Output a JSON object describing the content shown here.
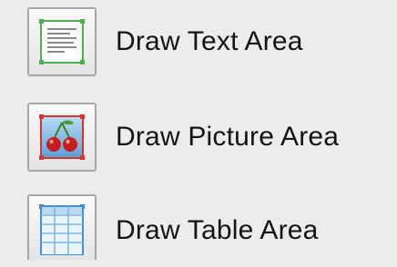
{
  "tools": [
    {
      "label": "Draw Text Area",
      "icon": "text-area-icon",
      "frame_color": "#4caf50"
    },
    {
      "label": "Draw Picture Area",
      "icon": "picture-area-icon",
      "frame_color": "#d9342b"
    },
    {
      "label": "Draw Table Area",
      "icon": "table-area-icon",
      "frame_color": "#3d8fd6"
    }
  ]
}
